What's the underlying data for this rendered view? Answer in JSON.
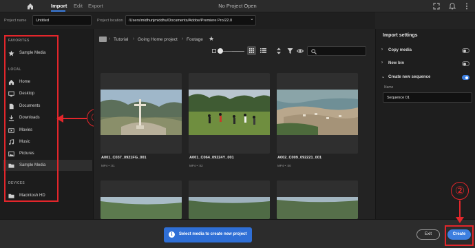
{
  "titlebar": {
    "tabs": [
      {
        "label": "Import",
        "active": true
      },
      {
        "label": "Edit",
        "active": false
      },
      {
        "label": "Export",
        "active": false
      }
    ],
    "window_title": "No Project Open",
    "icons": [
      "home-icon",
      "expand-icon",
      "notifications-icon",
      "more-icon"
    ]
  },
  "project": {
    "name_label": "Project name",
    "name_value": "Untitled",
    "location_label": "Project location",
    "location_value": "/Users/midhunjmiddhu/Documents/Adobe/Premiere Pro/22.0"
  },
  "sidebar": {
    "favorites_title": "FAVORITES",
    "favorites": [
      {
        "label": "Sample Media",
        "icon": "star-icon"
      }
    ],
    "local_title": "LOCAL",
    "local": [
      {
        "label": "Home",
        "icon": "home-icon"
      },
      {
        "label": "Desktop",
        "icon": "desktop-icon"
      },
      {
        "label": "Documents",
        "icon": "document-icon"
      },
      {
        "label": "Downloads",
        "icon": "download-icon"
      },
      {
        "label": "Movies",
        "icon": "movie-icon"
      },
      {
        "label": "Music",
        "icon": "music-icon"
      },
      {
        "label": "Pictures",
        "icon": "picture-icon"
      },
      {
        "label": "Sample Media",
        "icon": "folder-icon",
        "selected": true
      }
    ],
    "devices_title": "DEVICES",
    "devices": [
      {
        "label": "Macintosh HD",
        "icon": "drive-icon"
      }
    ]
  },
  "breadcrumb": [
    "Tutorial",
    "Going Home project",
    "Footage"
  ],
  "media": [
    {
      "name": "A001_C037_0921FG_001",
      "meta": "MP4 • :01"
    },
    {
      "name": "A001_C064_09224Y_001",
      "meta": "MP4 • :02"
    },
    {
      "name": "A002_C009_092221_001",
      "meta": "MP4 • :00"
    }
  ],
  "import_settings": {
    "title": "Import settings",
    "rows": [
      {
        "label": "Copy media",
        "on": false,
        "expanded": false
      },
      {
        "label": "New bin",
        "on": false,
        "expanded": false
      },
      {
        "label": "Create new sequence",
        "on": true,
        "expanded": true
      }
    ],
    "name_label": "Name",
    "name_value": "Sequence 01"
  },
  "bottom": {
    "notice": "Select media to create new project",
    "exit_label": "Exit",
    "create_label": "Create"
  },
  "annotations": {
    "marker1": "①",
    "marker2": "②"
  },
  "colors": {
    "accent": "#3d7fe0",
    "annotation": "#e3262b",
    "notice_bg": "#2f6fd6"
  }
}
